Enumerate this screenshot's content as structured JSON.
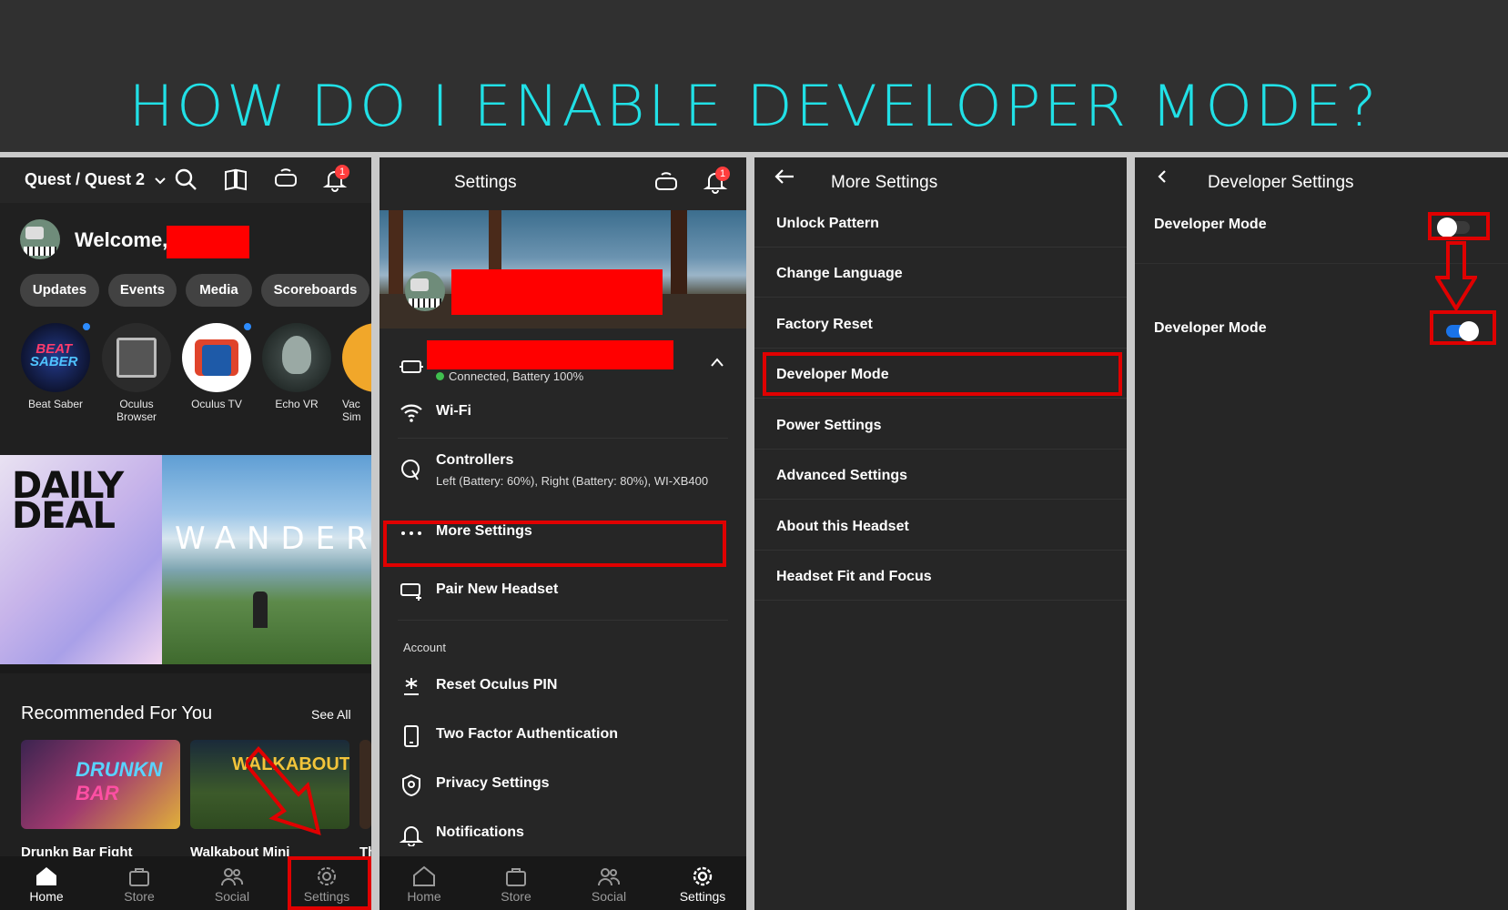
{
  "banner": {
    "title": "HOW DO I ENABLE DEVELOPER MODE?"
  },
  "colors": {
    "accent": "#21e0e6",
    "highlight": "#e00000",
    "toggle_on": "#1a73e8"
  },
  "home": {
    "headset_selector": "Quest / Quest 2",
    "notification_count": "1",
    "welcome": "Welcome,",
    "chips": [
      "Updates",
      "Events",
      "Media",
      "Scoreboards"
    ],
    "apps": [
      "Beat Saber",
      "Oculus Browser",
      "Oculus TV",
      "Echo VR",
      "Vac Sim"
    ],
    "daily_deal": "DAILY DEAL",
    "wander": "WANDER",
    "recommended": "Recommended For You",
    "see_all": "See All",
    "rec_items": [
      "Drunkn Bar Fight",
      "Walkabout Mini",
      "Th"
    ]
  },
  "nav": {
    "home": "Home",
    "store": "Store",
    "social": "Social",
    "settings": "Settings"
  },
  "settings": {
    "title": "Settings",
    "notification_count": "1",
    "device_status": "Connected, Battery 100%",
    "wifi": "Wi-Fi",
    "controllers": "Controllers",
    "controllers_sub": "Left (Battery: 60%), Right (Battery: 80%), WI-XB400",
    "more_settings": "More Settings",
    "pair": "Pair New Headset",
    "account": "Account",
    "reset_pin": "Reset Oculus PIN",
    "two_factor": "Two Factor Authentication",
    "privacy": "Privacy Settings",
    "notifications": "Notifications"
  },
  "more_settings": {
    "title": "More Settings",
    "items": [
      "Unlock Pattern",
      "Change Language",
      "Factory Reset",
      "Developer Mode",
      "Power Settings",
      "Advanced Settings",
      "About this Headset",
      "Headset Fit and Focus"
    ]
  },
  "developer": {
    "title": "Developer Settings",
    "label_off": "Developer Mode",
    "label_on": "Developer Mode"
  }
}
